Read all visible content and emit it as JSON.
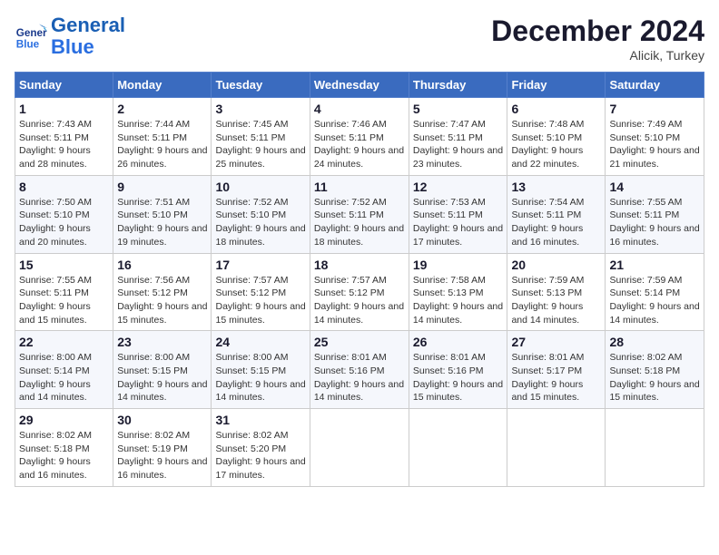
{
  "header": {
    "logo_line1": "General",
    "logo_line2": "Blue",
    "month": "December 2024",
    "location": "Alicik, Turkey"
  },
  "days_of_week": [
    "Sunday",
    "Monday",
    "Tuesday",
    "Wednesday",
    "Thursday",
    "Friday",
    "Saturday"
  ],
  "weeks": [
    [
      {
        "day": 1,
        "sunrise": "Sunrise: 7:43 AM",
        "sunset": "Sunset: 5:11 PM",
        "daylight": "Daylight: 9 hours and 28 minutes."
      },
      {
        "day": 2,
        "sunrise": "Sunrise: 7:44 AM",
        "sunset": "Sunset: 5:11 PM",
        "daylight": "Daylight: 9 hours and 26 minutes."
      },
      {
        "day": 3,
        "sunrise": "Sunrise: 7:45 AM",
        "sunset": "Sunset: 5:11 PM",
        "daylight": "Daylight: 9 hours and 25 minutes."
      },
      {
        "day": 4,
        "sunrise": "Sunrise: 7:46 AM",
        "sunset": "Sunset: 5:11 PM",
        "daylight": "Daylight: 9 hours and 24 minutes."
      },
      {
        "day": 5,
        "sunrise": "Sunrise: 7:47 AM",
        "sunset": "Sunset: 5:11 PM",
        "daylight": "Daylight: 9 hours and 23 minutes."
      },
      {
        "day": 6,
        "sunrise": "Sunrise: 7:48 AM",
        "sunset": "Sunset: 5:10 PM",
        "daylight": "Daylight: 9 hours and 22 minutes."
      },
      {
        "day": 7,
        "sunrise": "Sunrise: 7:49 AM",
        "sunset": "Sunset: 5:10 PM",
        "daylight": "Daylight: 9 hours and 21 minutes."
      }
    ],
    [
      {
        "day": 8,
        "sunrise": "Sunrise: 7:50 AM",
        "sunset": "Sunset: 5:10 PM",
        "daylight": "Daylight: 9 hours and 20 minutes."
      },
      {
        "day": 9,
        "sunrise": "Sunrise: 7:51 AM",
        "sunset": "Sunset: 5:10 PM",
        "daylight": "Daylight: 9 hours and 19 minutes."
      },
      {
        "day": 10,
        "sunrise": "Sunrise: 7:52 AM",
        "sunset": "Sunset: 5:10 PM",
        "daylight": "Daylight: 9 hours and 18 minutes."
      },
      {
        "day": 11,
        "sunrise": "Sunrise: 7:52 AM",
        "sunset": "Sunset: 5:11 PM",
        "daylight": "Daylight: 9 hours and 18 minutes."
      },
      {
        "day": 12,
        "sunrise": "Sunrise: 7:53 AM",
        "sunset": "Sunset: 5:11 PM",
        "daylight": "Daylight: 9 hours and 17 minutes."
      },
      {
        "day": 13,
        "sunrise": "Sunrise: 7:54 AM",
        "sunset": "Sunset: 5:11 PM",
        "daylight": "Daylight: 9 hours and 16 minutes."
      },
      {
        "day": 14,
        "sunrise": "Sunrise: 7:55 AM",
        "sunset": "Sunset: 5:11 PM",
        "daylight": "Daylight: 9 hours and 16 minutes."
      }
    ],
    [
      {
        "day": 15,
        "sunrise": "Sunrise: 7:55 AM",
        "sunset": "Sunset: 5:11 PM",
        "daylight": "Daylight: 9 hours and 15 minutes."
      },
      {
        "day": 16,
        "sunrise": "Sunrise: 7:56 AM",
        "sunset": "Sunset: 5:12 PM",
        "daylight": "Daylight: 9 hours and 15 minutes."
      },
      {
        "day": 17,
        "sunrise": "Sunrise: 7:57 AM",
        "sunset": "Sunset: 5:12 PM",
        "daylight": "Daylight: 9 hours and 15 minutes."
      },
      {
        "day": 18,
        "sunrise": "Sunrise: 7:57 AM",
        "sunset": "Sunset: 5:12 PM",
        "daylight": "Daylight: 9 hours and 14 minutes."
      },
      {
        "day": 19,
        "sunrise": "Sunrise: 7:58 AM",
        "sunset": "Sunset: 5:13 PM",
        "daylight": "Daylight: 9 hours and 14 minutes."
      },
      {
        "day": 20,
        "sunrise": "Sunrise: 7:59 AM",
        "sunset": "Sunset: 5:13 PM",
        "daylight": "Daylight: 9 hours and 14 minutes."
      },
      {
        "day": 21,
        "sunrise": "Sunrise: 7:59 AM",
        "sunset": "Sunset: 5:14 PM",
        "daylight": "Daylight: 9 hours and 14 minutes."
      }
    ],
    [
      {
        "day": 22,
        "sunrise": "Sunrise: 8:00 AM",
        "sunset": "Sunset: 5:14 PM",
        "daylight": "Daylight: 9 hours and 14 minutes."
      },
      {
        "day": 23,
        "sunrise": "Sunrise: 8:00 AM",
        "sunset": "Sunset: 5:15 PM",
        "daylight": "Daylight: 9 hours and 14 minutes."
      },
      {
        "day": 24,
        "sunrise": "Sunrise: 8:00 AM",
        "sunset": "Sunset: 5:15 PM",
        "daylight": "Daylight: 9 hours and 14 minutes."
      },
      {
        "day": 25,
        "sunrise": "Sunrise: 8:01 AM",
        "sunset": "Sunset: 5:16 PM",
        "daylight": "Daylight: 9 hours and 14 minutes."
      },
      {
        "day": 26,
        "sunrise": "Sunrise: 8:01 AM",
        "sunset": "Sunset: 5:16 PM",
        "daylight": "Daylight: 9 hours and 15 minutes."
      },
      {
        "day": 27,
        "sunrise": "Sunrise: 8:01 AM",
        "sunset": "Sunset: 5:17 PM",
        "daylight": "Daylight: 9 hours and 15 minutes."
      },
      {
        "day": 28,
        "sunrise": "Sunrise: 8:02 AM",
        "sunset": "Sunset: 5:18 PM",
        "daylight": "Daylight: 9 hours and 15 minutes."
      }
    ],
    [
      {
        "day": 29,
        "sunrise": "Sunrise: 8:02 AM",
        "sunset": "Sunset: 5:18 PM",
        "daylight": "Daylight: 9 hours and 16 minutes."
      },
      {
        "day": 30,
        "sunrise": "Sunrise: 8:02 AM",
        "sunset": "Sunset: 5:19 PM",
        "daylight": "Daylight: 9 hours and 16 minutes."
      },
      {
        "day": 31,
        "sunrise": "Sunrise: 8:02 AM",
        "sunset": "Sunset: 5:20 PM",
        "daylight": "Daylight: 9 hours and 17 minutes."
      },
      null,
      null,
      null,
      null
    ]
  ]
}
